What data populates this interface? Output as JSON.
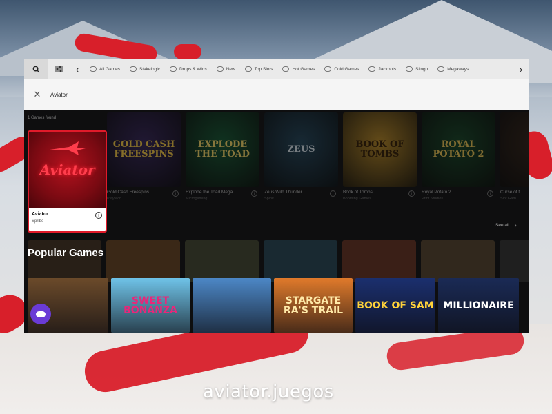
{
  "site": {
    "watermark": "aviator.juegos"
  },
  "nav": {
    "tabs": [
      {
        "label": "All Games"
      },
      {
        "label": "Stakelogic"
      },
      {
        "label": "Drops & Wins"
      },
      {
        "label": "New"
      },
      {
        "label": "Top Slots"
      },
      {
        "label": "Hot Games"
      },
      {
        "label": "Cold Games"
      },
      {
        "label": "Jackpots"
      },
      {
        "label": "Slingo"
      },
      {
        "label": "Megaways"
      }
    ]
  },
  "search": {
    "value": "Aviator",
    "results": "1 Games found"
  },
  "aviator": {
    "logo": "Aviator",
    "name": "Aviator",
    "provider": "Spribe"
  },
  "games": [
    {
      "name": "Gold Cash Freespins",
      "provider": "Playtech",
      "art": "GOLD CASH FREESPINS",
      "bg": "#3b2c5c",
      "fg": "#f2c94c"
    },
    {
      "name": "Explode the Toad Mega...",
      "provider": "Microgaming",
      "art": "EXPLODE THE TOAD",
      "bg": "#1e5b3a",
      "fg": "#f5d76e"
    },
    {
      "name": "Zeus Wild Thunder",
      "provider": "Spinit",
      "art": "ZEUS",
      "bg": "#2a4a5e",
      "fg": "#d9e4ec"
    },
    {
      "name": "Book of Tombs",
      "provider": "Booming Games",
      "art": "BOOK OF TOMBS",
      "bg": "#b5892e",
      "fg": "#3a2510"
    },
    {
      "name": "Royal Potato 2",
      "provider": "Print Studios",
      "art": "ROYAL POTATO 2",
      "bg": "#1f4a2e",
      "fg": "#e8c35a"
    },
    {
      "name": "Curse of t",
      "provider": "Slot Gam",
      "art": "",
      "bg": "#3a2b22",
      "fg": "#c99a5b"
    }
  ],
  "see_all": "See all",
  "popular": {
    "title": "Popular Games",
    "items": [
      {
        "art": "",
        "bg": "#6b4a2a",
        "fg": "#f4d9a0"
      },
      {
        "art": "SWEET BONANZA",
        "bg": "#6fc3e8",
        "fg": "#e8277a"
      },
      {
        "art": "",
        "bg": "#4c87c6",
        "fg": "#ffffff"
      },
      {
        "art": "STARGATE RA'S TRAIL",
        "bg": "#e07a2b",
        "fg": "#ffe9a8"
      },
      {
        "art": "BOOK OF SAM",
        "bg": "#1b2f6e",
        "fg": "#ffd23a"
      },
      {
        "art": "MILLIONAIRE",
        "bg": "#1a2a55",
        "fg": "#ffffff"
      }
    ]
  }
}
